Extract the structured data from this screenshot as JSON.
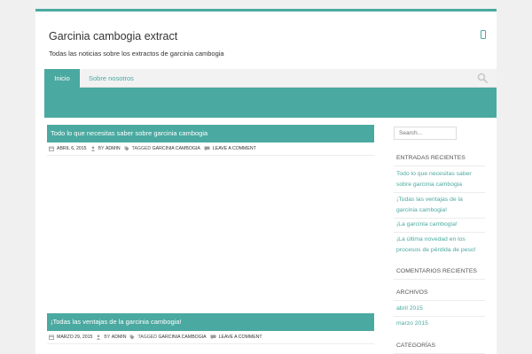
{
  "site": {
    "title": "Garcinia cambogia extract",
    "description": "Todas las noticias sobre los extractos de garcinia cambogia"
  },
  "nav": {
    "items": [
      {
        "label": "Inicio",
        "active": true
      },
      {
        "label": "Sobre nosotros",
        "active": false
      }
    ]
  },
  "posts": [
    {
      "title": "Todo lo que necesitas saber sobre garcinia cambogia",
      "date": "Abril 6, 2015",
      "by_prefix": "By",
      "author": "Admin",
      "tagged_prefix": "Tagged",
      "tag": "Garcinia Cambogia",
      "comment_link": "Leave a comment"
    },
    {
      "title": "¡Todas las ventajas de la garcinia cambogia!",
      "date": "Marzo 29, 2015",
      "by_prefix": "By",
      "author": "Admin",
      "tagged_prefix": "Tagged",
      "tag": "Garcinia Cambogia",
      "comment_link": "Leave a comment"
    }
  ],
  "sidebar": {
    "search_placeholder": "Search...",
    "recent_posts_title": "Entradas recientes",
    "recent_posts": [
      "Todo lo que necesitas saber sobre garcinia cambogia",
      "¡Todas las ventajas de la garcinia cambogia!",
      "¡La garcinia cambogia!",
      "¡La última novedad en los procesos de pérdida de peso!"
    ],
    "recent_comments_title": "Comentarios recientes",
    "archives_title": "Archivos",
    "archives": [
      "abril 2015",
      "marzo 2015"
    ],
    "categories_title": "Categorías"
  },
  "colors": {
    "accent": "#4aa9a0",
    "nav_background": "#f2f2f2"
  },
  "icons": [
    "mobile-icon",
    "search-icon",
    "calendar-icon",
    "user-icon",
    "tag-icon",
    "comment-icon"
  ]
}
